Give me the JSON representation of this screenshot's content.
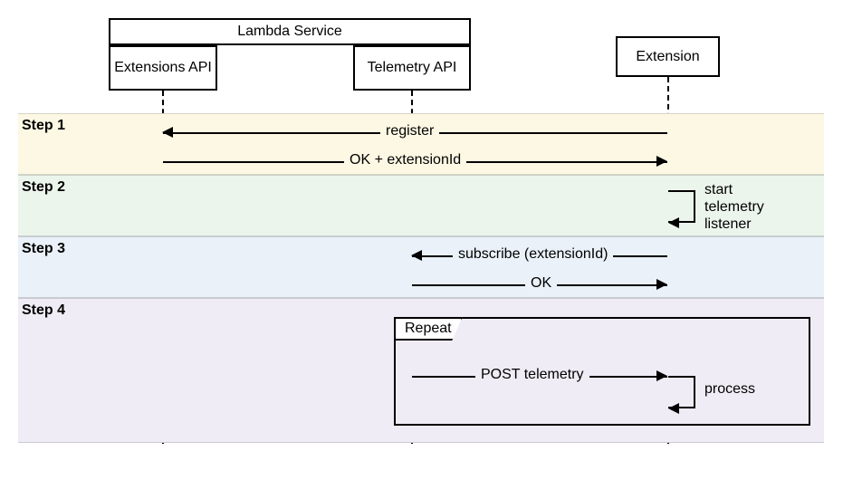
{
  "header": {
    "lambda_service": "Lambda Service",
    "extensions_api": "Extensions API",
    "telemetry_api": "Telemetry API",
    "extension": "Extension"
  },
  "steps": {
    "s1": "Step 1",
    "s2": "Step 2",
    "s3": "Step 3",
    "s4": "Step 4"
  },
  "messages": {
    "register": "register",
    "ok_extid": "OK + extensionId",
    "start_listener": "start telemetry listener",
    "subscribe": "subscribe (extensionId)",
    "ok": "OK",
    "repeat": "Repeat",
    "post_telemetry": "POST telemetry",
    "process": "process"
  },
  "colors": {
    "step1": "#fdf8e3",
    "step2": "#ecf5ec",
    "step3": "#eaf1f9",
    "step4": "#f0ecf5"
  }
}
